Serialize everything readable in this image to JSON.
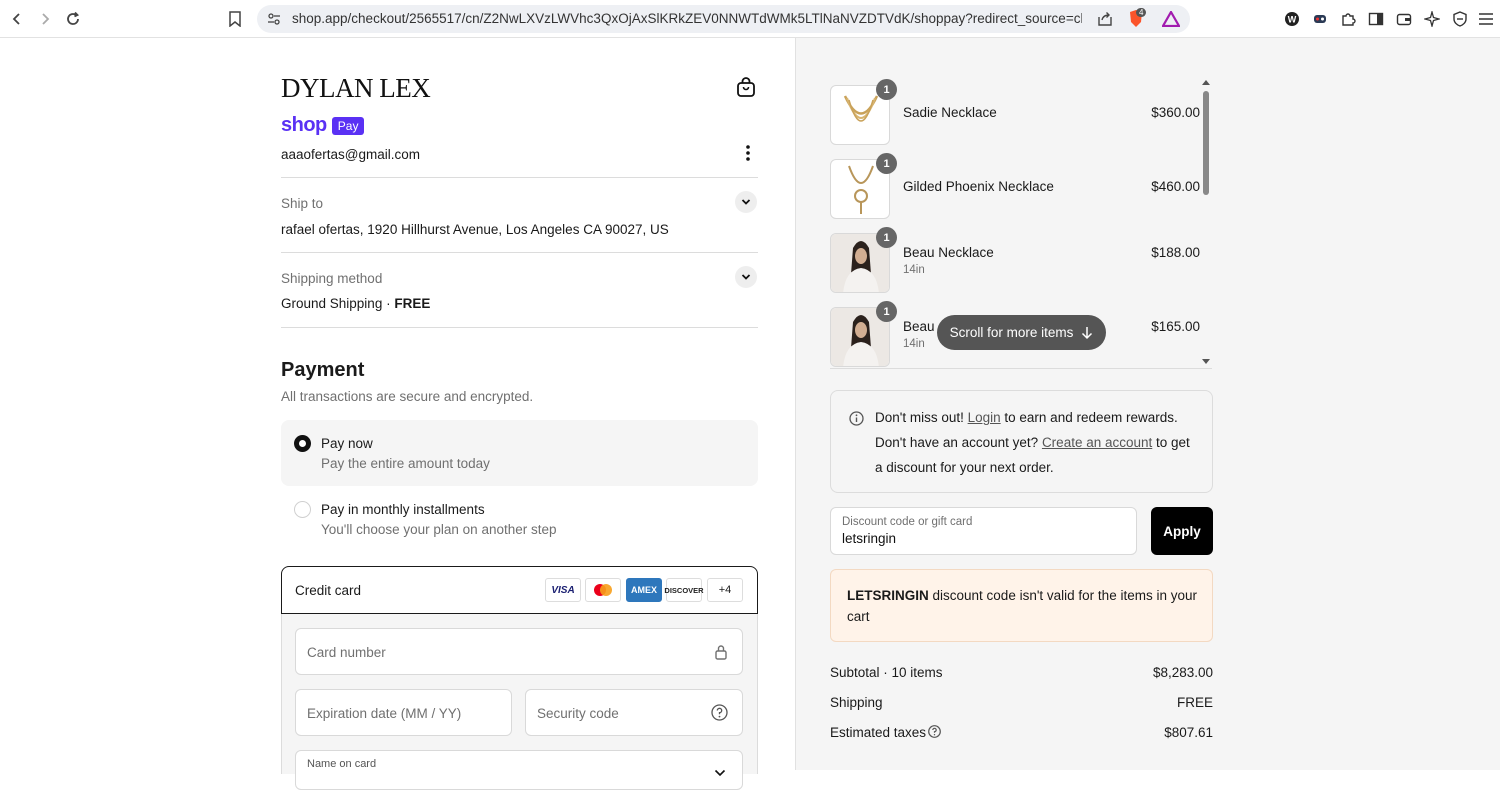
{
  "browser": {
    "url": "shop.app/checkout/2565517/cn/Z2NwLXVzLWVhc3QxOjAxSlKRkZEV0NNWTdWMk5LTlNaNVZDTVdK/shoppay?redirect_source=chec...",
    "brave_badge": "4"
  },
  "store": {
    "logo": "DYLAN LEX",
    "shop_word": "shop",
    "pay_word": "Pay",
    "email": "aaaofertas@gmail.com"
  },
  "ship": {
    "label": "Ship to",
    "value": "rafael ofertas, 1920 Hillhurst Avenue, Los Angeles CA 90027, US"
  },
  "shipping_method": {
    "label": "Shipping method",
    "value": "Ground Shipping · ",
    "free": "FREE"
  },
  "payment": {
    "title": "Payment",
    "subtitle": "All transactions are secure and encrypted.",
    "options": [
      {
        "title": "Pay now",
        "sub": "Pay the entire amount today"
      },
      {
        "title": "Pay in monthly installments",
        "sub": "You'll choose your plan on another step"
      }
    ],
    "credit_card_label": "Credit card",
    "cards": [
      "VISA",
      "MC",
      "AMEX",
      "DISCOVER"
    ],
    "more_cards": "+4",
    "card_number_ph": "Card number",
    "expiry_ph": "Expiration date (MM / YY)",
    "security_ph": "Security code",
    "name_ph": "Name on card"
  },
  "cart": {
    "items": [
      {
        "qty": "1",
        "name": "Sadie Necklace",
        "variant": "",
        "price": "$360.00"
      },
      {
        "qty": "1",
        "name": "Gilded Phoenix Necklace",
        "variant": "",
        "price": "$460.00"
      },
      {
        "qty": "1",
        "name": "Beau Necklace",
        "variant": "14in",
        "price": "$188.00"
      },
      {
        "qty": "1",
        "name": "Beau",
        "variant": "14in",
        "price": "$165.00"
      }
    ],
    "scroll_hint": "Scroll for more items"
  },
  "rewards": {
    "line1_a": "Don't miss out! ",
    "login": "Login",
    "line1_b": " to earn and redeem rewards.",
    "line2_a": "Don't have an account yet? ",
    "create": "Create an account",
    "line2_b": " to get",
    "line3": "a discount for your next order."
  },
  "discount": {
    "label": "Discount code or gift card",
    "value": "letsringin",
    "apply": "Apply",
    "error_code": "LETSRINGIN",
    "error_rest": " discount code isn't valid for the items in your",
    "error_line2": "cart"
  },
  "summary": {
    "subtotal_label": "Subtotal · 10 items",
    "subtotal": "$8,283.00",
    "shipping_label": "Shipping",
    "shipping": "FREE",
    "taxes_label": "Estimated taxes",
    "taxes": "$807.61"
  }
}
